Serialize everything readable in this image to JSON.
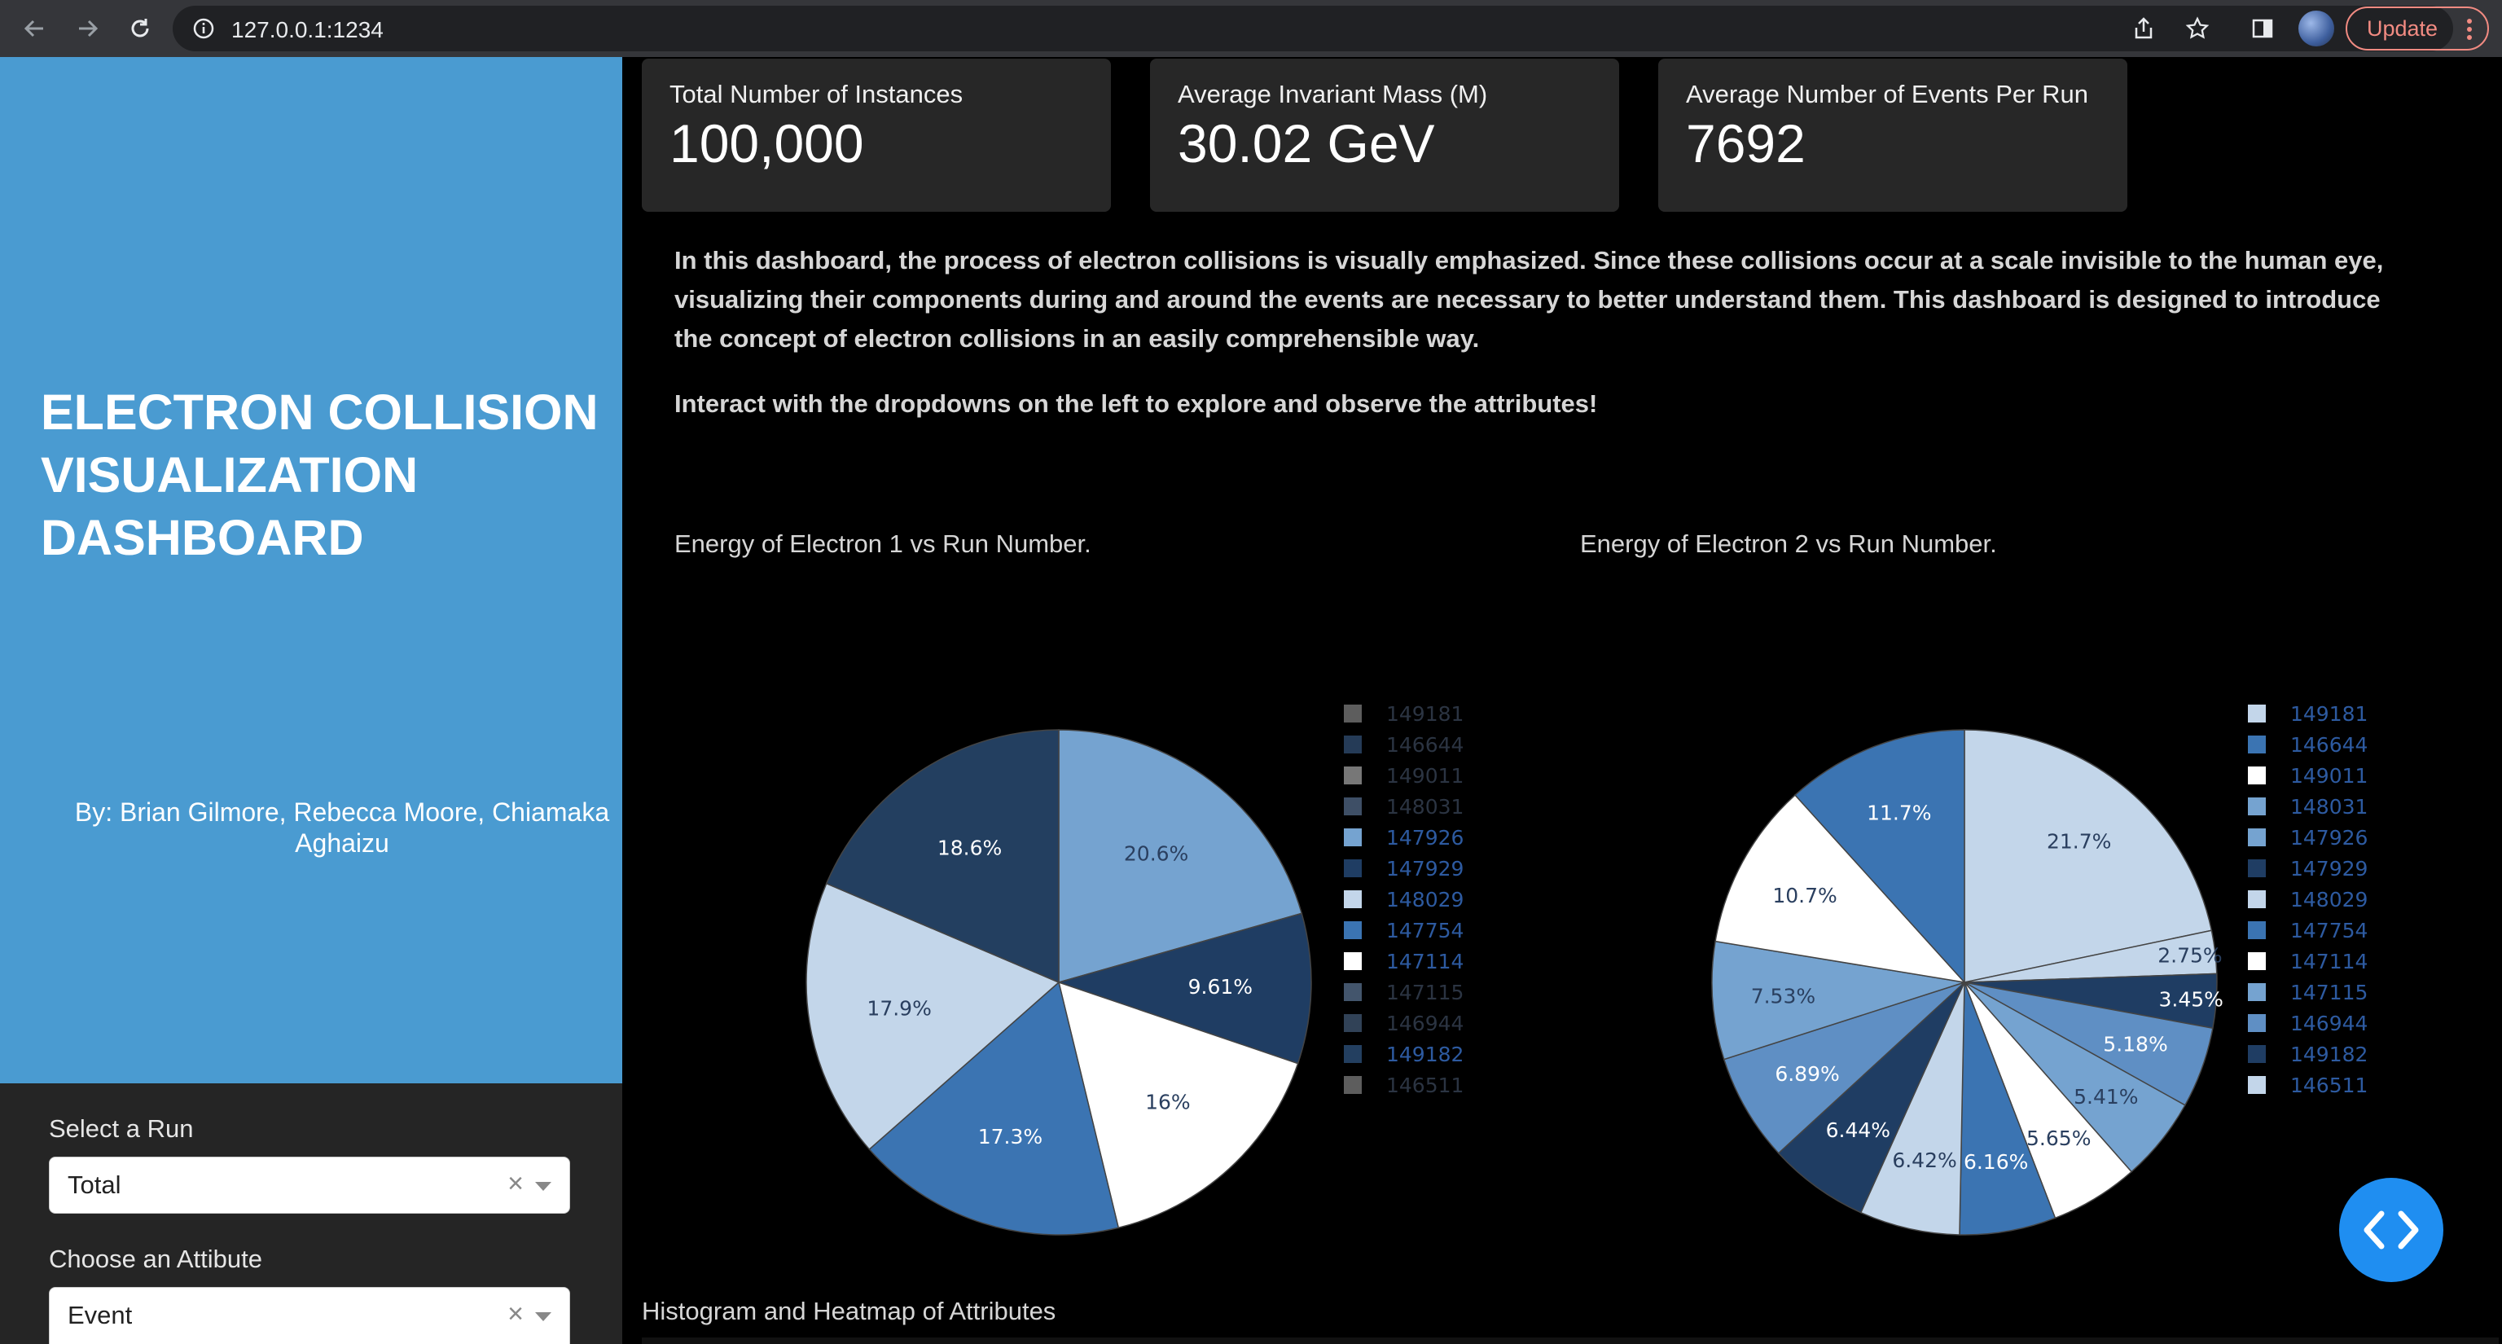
{
  "browser": {
    "url": "127.0.0.1:1234",
    "update_label": "Update"
  },
  "sidebar": {
    "title": "ELECTRON COLLISION VISUALIZATION DASHBOARD",
    "authors": "By: Brian Gilmore, Rebecca Moore, Chiamaka Aghaizu",
    "select_run_label": "Select a Run",
    "select_run_value": "Total",
    "attribute_label": "Choose an Attibute",
    "attribute_value": "Event",
    "clear_symbol": "×"
  },
  "kpis": [
    {
      "label": "Total Number of Instances",
      "value": "100,000"
    },
    {
      "label": "Average Invariant Mass (M)",
      "value": "30.02 GeV"
    },
    {
      "label": "Average Number of Events Per Run",
      "value": "7692"
    }
  ],
  "intro": {
    "paragraph1": "In this dashboard, the process of electron collisions is visually emphasized. Since these collisions occur at a scale invisible to the human eye, visualizing their components during and around the events are necessary to better understand them. This dashboard is designed to introduce the concept of electron collisions in an easily comprehensible way.",
    "paragraph2": "Interact with the dropdowns on the left to explore and observe the attributes!"
  },
  "section_title": "Histogram and Heatmap of Attributes",
  "chart_data": [
    {
      "type": "pie",
      "title": "Energy of Electron 1 vs Run Number.",
      "legend_position": "right",
      "slices": [
        {
          "label": "20.6%",
          "value": 20.6,
          "color": "#75a3d0"
        },
        {
          "label": "9.61%",
          "value": 9.61,
          "color": "#1f3d63"
        },
        {
          "label": "16%",
          "value": 16.0,
          "color": "#ffffff"
        },
        {
          "label": "17.3%",
          "value": 17.3,
          "color": "#3b74b2"
        },
        {
          "label": "17.9%",
          "value": 17.9,
          "color": "#c3d6ea"
        },
        {
          "label": "18.6%",
          "value": 18.6,
          "color": "#233f60"
        }
      ],
      "legend": [
        {
          "label": "149181",
          "color": "#6d6d6d",
          "active": false
        },
        {
          "label": "146644",
          "color": "#2c4566",
          "active": false
        },
        {
          "label": "149011",
          "color": "#8c8c8c",
          "active": false
        },
        {
          "label": "148031",
          "color": "#495d78",
          "active": false
        },
        {
          "label": "147926",
          "color": "#75a3d0",
          "active": true
        },
        {
          "label": "147929",
          "color": "#1f3d63",
          "active": true
        },
        {
          "label": "148029",
          "color": "#c3d6ea",
          "active": true
        },
        {
          "label": "147754",
          "color": "#3b74b2",
          "active": true
        },
        {
          "label": "147114",
          "color": "#ffffff",
          "active": true
        },
        {
          "label": "147115",
          "color": "#4f647f",
          "active": false
        },
        {
          "label": "146944",
          "color": "#3a4d66",
          "active": false
        },
        {
          "label": "149182",
          "color": "#233f60",
          "active": true
        },
        {
          "label": "146511",
          "color": "#6d6d6d",
          "active": false
        }
      ]
    },
    {
      "type": "pie",
      "title": "Energy of Electron 2 vs Run Number.",
      "legend_position": "right",
      "slices": [
        {
          "label": "21.7%",
          "value": 21.7,
          "color": "#c3d6ea"
        },
        {
          "label": "2.75%",
          "value": 2.75,
          "color": "#c3d6ea"
        },
        {
          "label": "3.45%",
          "value": 3.45,
          "color": "#1f3d63"
        },
        {
          "label": "5.18%",
          "value": 5.18,
          "color": "#5f8fc4"
        },
        {
          "label": "5.41%",
          "value": 5.41,
          "color": "#75a3d0"
        },
        {
          "label": "5.65%",
          "value": 5.65,
          "color": "#ffffff"
        },
        {
          "label": "6.16%",
          "value": 6.16,
          "color": "#3b74b2"
        },
        {
          "label": "6.42%",
          "value": 6.42,
          "color": "#c3d6ea"
        },
        {
          "label": "6.44%",
          "value": 6.44,
          "color": "#1f3d63"
        },
        {
          "label": "6.89%",
          "value": 6.89,
          "color": "#5f8fc4"
        },
        {
          "label": "7.53%",
          "value": 7.53,
          "color": "#75a3d0"
        },
        {
          "label": "10.7%",
          "value": 10.7,
          "color": "#ffffff"
        },
        {
          "label": "11.7%",
          "value": 11.7,
          "color": "#3b74b2"
        }
      ],
      "legend": [
        {
          "label": "149181",
          "color": "#c3d6ea",
          "active": true
        },
        {
          "label": "146644",
          "color": "#3b74b2",
          "active": true
        },
        {
          "label": "149011",
          "color": "#ffffff",
          "active": true
        },
        {
          "label": "148031",
          "color": "#75a3d0",
          "active": true
        },
        {
          "label": "147926",
          "color": "#75a3d0",
          "active": true
        },
        {
          "label": "147929",
          "color": "#1f3d63",
          "active": true
        },
        {
          "label": "148029",
          "color": "#c3d6ea",
          "active": true
        },
        {
          "label": "147754",
          "color": "#3b74b2",
          "active": true
        },
        {
          "label": "147114",
          "color": "#ffffff",
          "active": true
        },
        {
          "label": "147115",
          "color": "#75a3d0",
          "active": true
        },
        {
          "label": "146944",
          "color": "#5f8fc4",
          "active": true
        },
        {
          "label": "149182",
          "color": "#1f3d63",
          "active": true
        },
        {
          "label": "146511",
          "color": "#c3d6ea",
          "active": true
        }
      ]
    }
  ]
}
